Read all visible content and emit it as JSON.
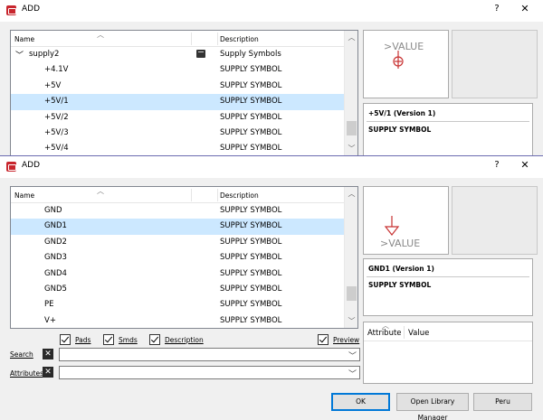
{
  "window1": {
    "title": "ADD",
    "help": "?",
    "close": "✕",
    "list": {
      "col_name": "Name",
      "col_desc": "Description",
      "group": {
        "name": "supply2",
        "desc": "Supply Symbols"
      },
      "rows": [
        {
          "name": "+4.1V",
          "desc": "SUPPLY SYMBOL"
        },
        {
          "name": "+5V",
          "desc": "SUPPLY SYMBOL"
        },
        {
          "name": "+5V/1",
          "desc": "SUPPLY SYMBOL"
        },
        {
          "name": "+5V/2",
          "desc": "SUPPLY SYMBOL"
        },
        {
          "name": "+5V/3",
          "desc": "SUPPLY SYMBOL"
        },
        {
          "name": "+5V/4",
          "desc": "SUPPLY SYMBOL"
        }
      ],
      "selected_index": 2
    },
    "preview": {
      "symbol_label": ">VALUE"
    },
    "info": {
      "title": "+5V/1 (Version 1)",
      "desc": "SUPPLY SYMBOL"
    }
  },
  "window2": {
    "title": "ADD",
    "help": "?",
    "close": "✕",
    "list": {
      "col_name": "Name",
      "col_desc": "Description",
      "rows": [
        {
          "name": "GND",
          "desc": "SUPPLY SYMBOL"
        },
        {
          "name": "GND1",
          "desc": "SUPPLY SYMBOL"
        },
        {
          "name": "GND2",
          "desc": "SUPPLY SYMBOL"
        },
        {
          "name": "GND3",
          "desc": "SUPPLY SYMBOL"
        },
        {
          "name": "GND4",
          "desc": "SUPPLY SYMBOL"
        },
        {
          "name": "GND5",
          "desc": "SUPPLY SYMBOL"
        },
        {
          "name": "PE",
          "desc": "SUPPLY SYMBOL"
        },
        {
          "name": "V+",
          "desc": "SUPPLY SYMBOL"
        }
      ],
      "selected_index": 1
    },
    "preview": {
      "symbol_label": ">VALUE"
    },
    "info": {
      "title": "GND1 (Version 1)",
      "desc": "SUPPLY SYMBOL"
    },
    "attributes": {
      "col_attribute": "Attribute",
      "col_value": "Value"
    },
    "checkboxes": {
      "pads": "Pads",
      "smds": "Smds",
      "description": "Description",
      "preview": "Preview"
    },
    "search": {
      "label": "Search",
      "value": ""
    },
    "attributes_filter": {
      "label": "Attributes",
      "value": ""
    },
    "buttons": {
      "ok": "OK",
      "library_manager": "Open Library Manager",
      "cancel": "Peru"
    }
  }
}
